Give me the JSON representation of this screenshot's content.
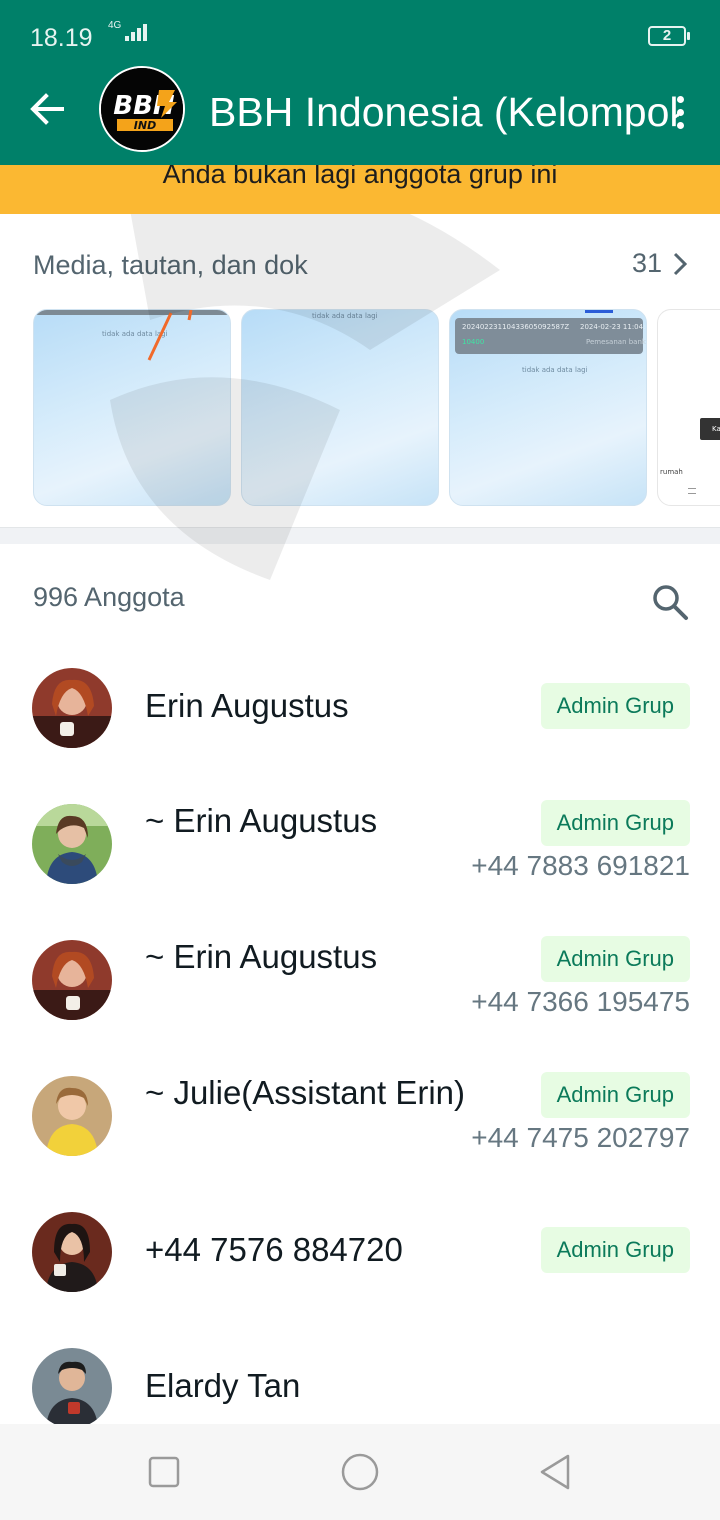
{
  "status_bar": {
    "time": "18.19",
    "network": "4G",
    "battery": "2"
  },
  "header": {
    "title": "BBH Indonesia (Kelompok",
    "logo_text": "BBH",
    "logo_sub": "IND"
  },
  "banner": {
    "text": "Anda bukan lagi anggota grup ini"
  },
  "media": {
    "heading": "Media, tautan, dan dok",
    "count": "31",
    "thumbs": [
      {
        "caption": "tidak ada data lagi"
      },
      {
        "caption": "tidak ada data lagi"
      },
      {
        "caption": "tidak ada data lagi",
        "top_id": "20240223110433605092587Z",
        "top_date": "2024-02-23 11:04:33",
        "amount": "10400",
        "status": "Pemesanan bank"
      },
      {
        "caption": "rumah",
        "chip": "Ka"
      }
    ]
  },
  "members": {
    "count_label": "996 Anggota",
    "items": [
      {
        "name": "Erin Augustus",
        "phone": "",
        "badge": "Admin Grup"
      },
      {
        "name": "~ Erin Augustus",
        "phone": "+44 7883 691821",
        "badge": "Admin Grup"
      },
      {
        "name": "~ Erin Augustus",
        "phone": "+44 7366 195475",
        "badge": "Admin Grup"
      },
      {
        "name": "~ Julie(Assistant Erin)",
        "phone": "+44 7475 202797",
        "badge": "Admin Grup"
      },
      {
        "name": "+44 7576 884720",
        "phone": "",
        "badge": "Admin Grup"
      },
      {
        "name": "Elardy Tan",
        "phone": "",
        "badge": ""
      }
    ]
  },
  "colors": {
    "header": "#008069",
    "banner": "#fbb832",
    "badge_bg": "#e7fce3",
    "badge_text": "#0b7a5a"
  },
  "icons": [
    "back-arrow-icon",
    "more-vertical-icon",
    "chevron-right-icon",
    "search-icon",
    "square-nav-icon",
    "circle-nav-icon",
    "triangle-back-nav-icon"
  ]
}
